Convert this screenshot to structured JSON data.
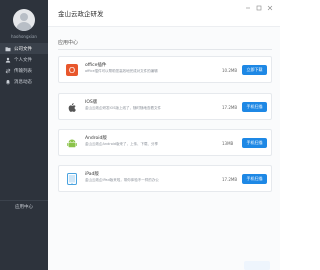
{
  "app": {
    "title": "金山云政企研发"
  },
  "sidebar": {
    "username": "haohongxian",
    "items": [
      {
        "label": "公司文件",
        "active": true
      },
      {
        "label": "个人文件",
        "active": false
      },
      {
        "label": "传输列表",
        "active": false
      },
      {
        "label": "消息动态",
        "active": false
      }
    ],
    "footer": "应用中心"
  },
  "main": {
    "section_title": "应用中心",
    "apps": [
      {
        "name": "office插件",
        "desc": "office插件可以帮助您高效地完成对文件的编辑",
        "size": "10.2MB",
        "button": "立即下载",
        "icon": "office-icon",
        "color": "#e8572c"
      },
      {
        "name": "IOS版",
        "desc": "金山云政企研发IOS版上线了，随时随地查看文件",
        "size": "17.2MB",
        "button": "手机扫描",
        "icon": "apple-icon",
        "color": "#555555"
      },
      {
        "name": "Android版",
        "desc": "金山云政企Android版来了，上传、下载、分享",
        "size": "13MB",
        "button": "手机扫描",
        "icon": "android-icon",
        "color": "#8bc34a"
      },
      {
        "name": "iPad版",
        "desc": "金山云政企iPad版来啦，带你体验不一样的办公",
        "size": "17.2MB",
        "button": "手机扫描",
        "icon": "ipad-icon",
        "color": "#4aa3df"
      }
    ]
  }
}
